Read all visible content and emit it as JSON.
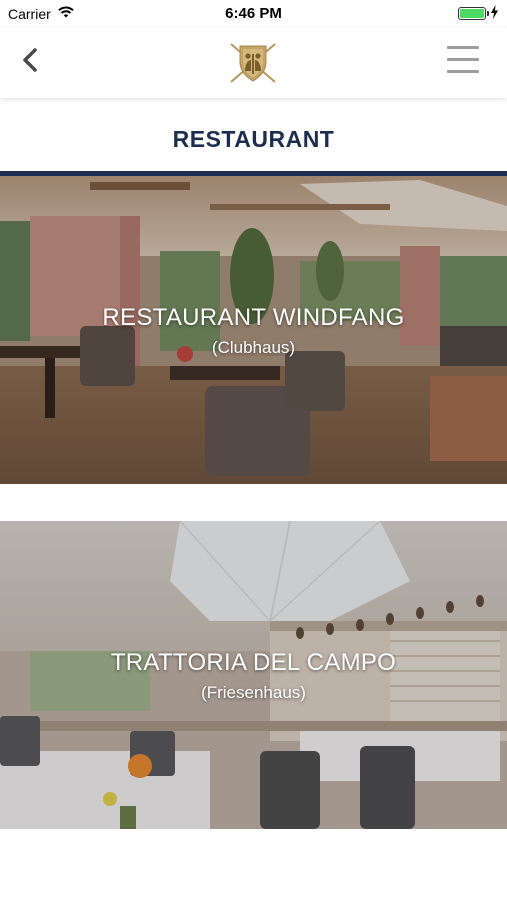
{
  "status_bar": {
    "carrier": "Carrier",
    "time": "6:46 PM",
    "icons": [
      "wifi-icon",
      "battery-icon",
      "charging-icon"
    ]
  },
  "nav": {
    "back_icon": "chevron-left-icon",
    "logo_icon": "club-crest-logo",
    "menu_icon": "hamburger-menu-icon"
  },
  "page": {
    "title": "RESTAURANT"
  },
  "restaurants": [
    {
      "name": "RESTAURANT WINDFANG",
      "location": "(Clubhaus)"
    },
    {
      "name": "TRATTORIA DEL CAMPO",
      "location": "(Friesenhaus)"
    }
  ],
  "colors": {
    "title": "#1c2d50",
    "accent_rule": "#1c2d50",
    "logo_gold": "#b8995a",
    "menu_gray": "#9c9c9c",
    "battery": "#4cd964"
  }
}
